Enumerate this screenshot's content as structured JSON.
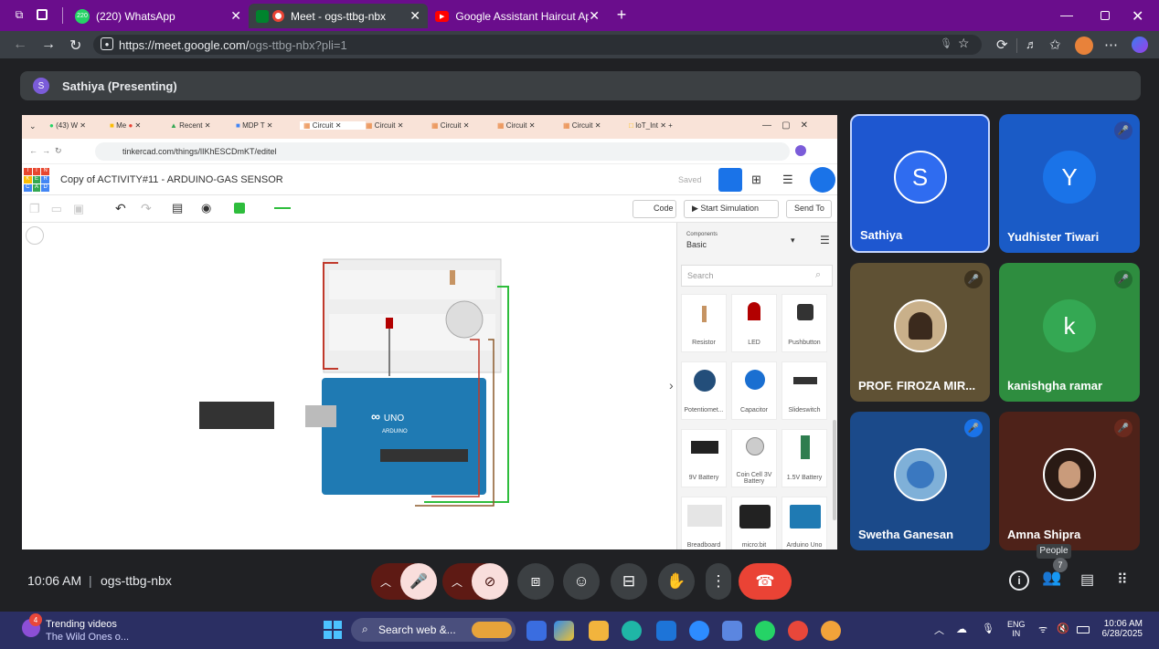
{
  "browser": {
    "tabs": [
      {
        "label": "(220) WhatsApp",
        "badge": "220"
      },
      {
        "label": "Meet - ogs-ttbg-nbx"
      },
      {
        "label": "Google Assistant Haircut Appoint"
      }
    ],
    "url_host": "https://meet.google.com/",
    "url_path": "ogs-ttbg-nbx?pli=1"
  },
  "meet": {
    "presenter_initial": "S",
    "presenter_label": "Sathiya (Presenting)",
    "time": "10:06 AM",
    "separator": "|",
    "meeting_code": "ogs-ttbg-nbx",
    "people_tooltip": "People",
    "people_count": "7",
    "participants": [
      {
        "initial": "S",
        "name": "Sathiya",
        "color": "#1e57d0"
      },
      {
        "initial": "Y",
        "name": "Yudhister Tiwari",
        "color": "#1a73e8"
      },
      {
        "initial": "",
        "name": "PROF. FIROZA MIR...",
        "color": "#6b5a3c"
      },
      {
        "initial": "k",
        "name": "kanishgha ramar",
        "color": "#34a853"
      },
      {
        "initial": "",
        "name": "Swetha Ganesan",
        "color": "#1b4a8a"
      },
      {
        "initial": "",
        "name": "Amna Shipra",
        "color": "#5d2a1e"
      }
    ]
  },
  "shared": {
    "tabs": [
      "(43) W",
      "Me",
      "Recent",
      "MDP T",
      "Circuit",
      "Circuit",
      "Circuit",
      "Circuit",
      "Circuit",
      "IoT_Int"
    ],
    "url": "tinkercad.com/things/lIKhESCDmKT/editel",
    "logo_letters": [
      "T",
      "I",
      "N",
      "K",
      "E",
      "R",
      "C",
      "A",
      "D"
    ],
    "project_title": "Copy of ACTIVITY#11 - ARDUINO-GAS SENSOR",
    "saved": "Saved",
    "code_btn": "Code",
    "sim_btn": "Start Simulation",
    "send_btn": "Send To",
    "components_label": "Components",
    "components_value": "Basic",
    "search_placeholder": "Search",
    "arduino_text": "UNO",
    "arduino_brand": "ARDUINO",
    "components": [
      "Resistor",
      "LED",
      "Pushbutton",
      "Potentiomet...",
      "Capacitor",
      "Slideswitch",
      "9V Battery",
      "Coin Cell 3V Battery",
      "1.5V Battery",
      "Breadboard",
      "micro:bit",
      "Arduino Uno"
    ]
  },
  "taskbar": {
    "trending_title": "Trending videos",
    "trending_sub": "The Wild Ones o...",
    "trending_badge": "4",
    "search_label": "Search web &...",
    "lang_line1": "ENG",
    "lang_line2": "IN",
    "clock_time": "10:06 AM",
    "clock_date": "6/28/2025"
  }
}
